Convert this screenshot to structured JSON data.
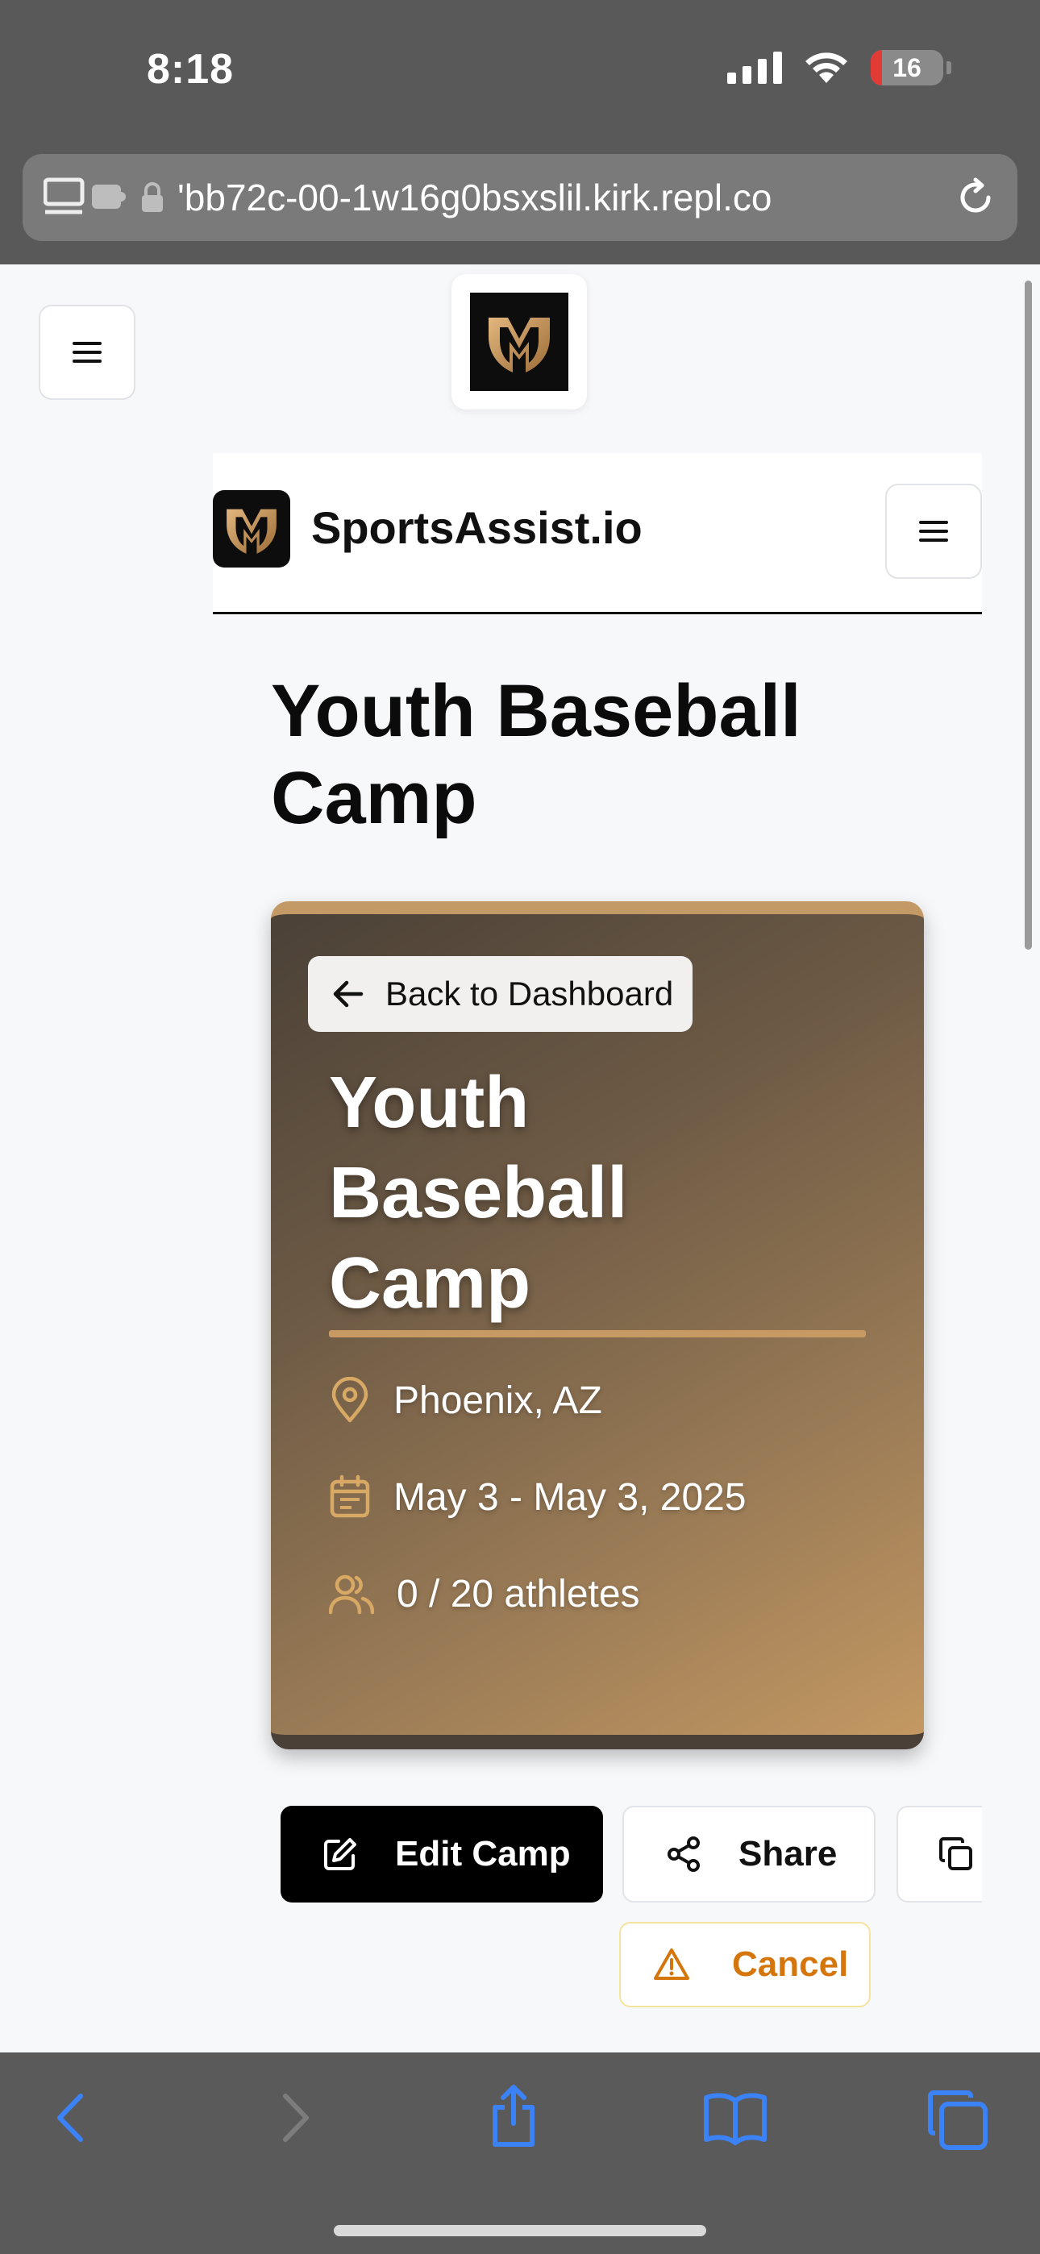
{
  "status_bar": {
    "time": "8:18",
    "battery": "16",
    "battery_color": "#e23b35"
  },
  "browser": {
    "url": "'bb72c-00-1w16g0bsxslil.kirk.repl.co"
  },
  "icons": [
    "menu-icon",
    "lock-icon",
    "reload-icon",
    "arrow-left-icon",
    "map-pin-icon",
    "calendar-icon",
    "users-icon",
    "edit-icon",
    "share-icon",
    "copy-icon",
    "warning-icon",
    "back-icon",
    "forward-icon",
    "share-up-icon",
    "bookmarks-icon",
    "tabs-icon"
  ],
  "nav": {
    "brand": "SportsAssist.io"
  },
  "page": {
    "title": "Youth Baseball Camp"
  },
  "hero": {
    "back_label": "Back to Dashboard",
    "title": "Youth Baseball Camp",
    "location": "Phoenix, AZ",
    "dates": "May 3 - May 3, 2025",
    "athletes": "0 / 20 athletes",
    "accent_color": "#c79a64"
  },
  "actions": {
    "edit": "Edit Camp",
    "share": "Share",
    "cancel": "Cancel"
  },
  "colors": {
    "toolbar_accent": "#3b82f6",
    "cancel_accent": "#d5760d"
  }
}
